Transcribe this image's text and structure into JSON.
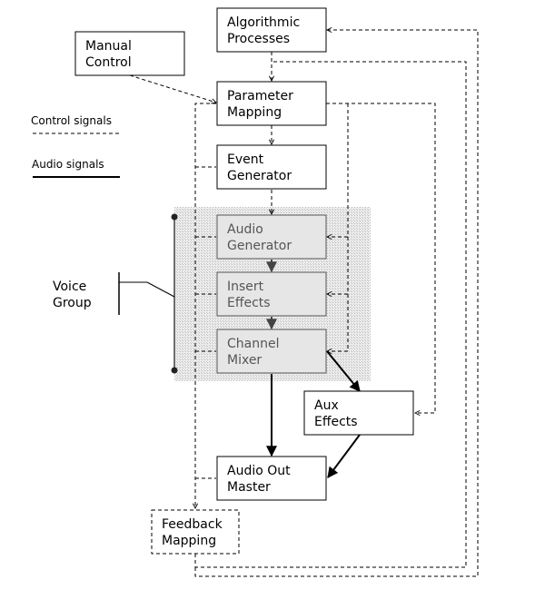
{
  "legend": {
    "control_label": "Control signals",
    "audio_label": "Audio signals"
  },
  "voice_group": {
    "line1": "Voice",
    "line2": "Group"
  },
  "nodes": {
    "algorithmic": {
      "line1": "Algorithmic",
      "line2": "Processes"
    },
    "manual": {
      "line1": "Manual",
      "line2": "Control"
    },
    "parameter": {
      "line1": "Parameter",
      "line2": "Mapping"
    },
    "event": {
      "line1": "Event",
      "line2": "Generator"
    },
    "audio_gen": {
      "line1": "Audio",
      "line2": "Generator"
    },
    "insert": {
      "line1": "Insert",
      "line2": "Effects"
    },
    "mixer": {
      "line1": "Channel",
      "line2": "Mixer"
    },
    "aux": {
      "line1": "Aux",
      "line2": "Effects"
    },
    "out": {
      "line1": "Audio Out",
      "line2": "Master"
    },
    "feedback": {
      "line1": "Feedback",
      "line2": "Mapping"
    }
  },
  "colors": {
    "voice_group_fill": "#e6e6e6",
    "voice_group_hatch": "#cccccc"
  }
}
